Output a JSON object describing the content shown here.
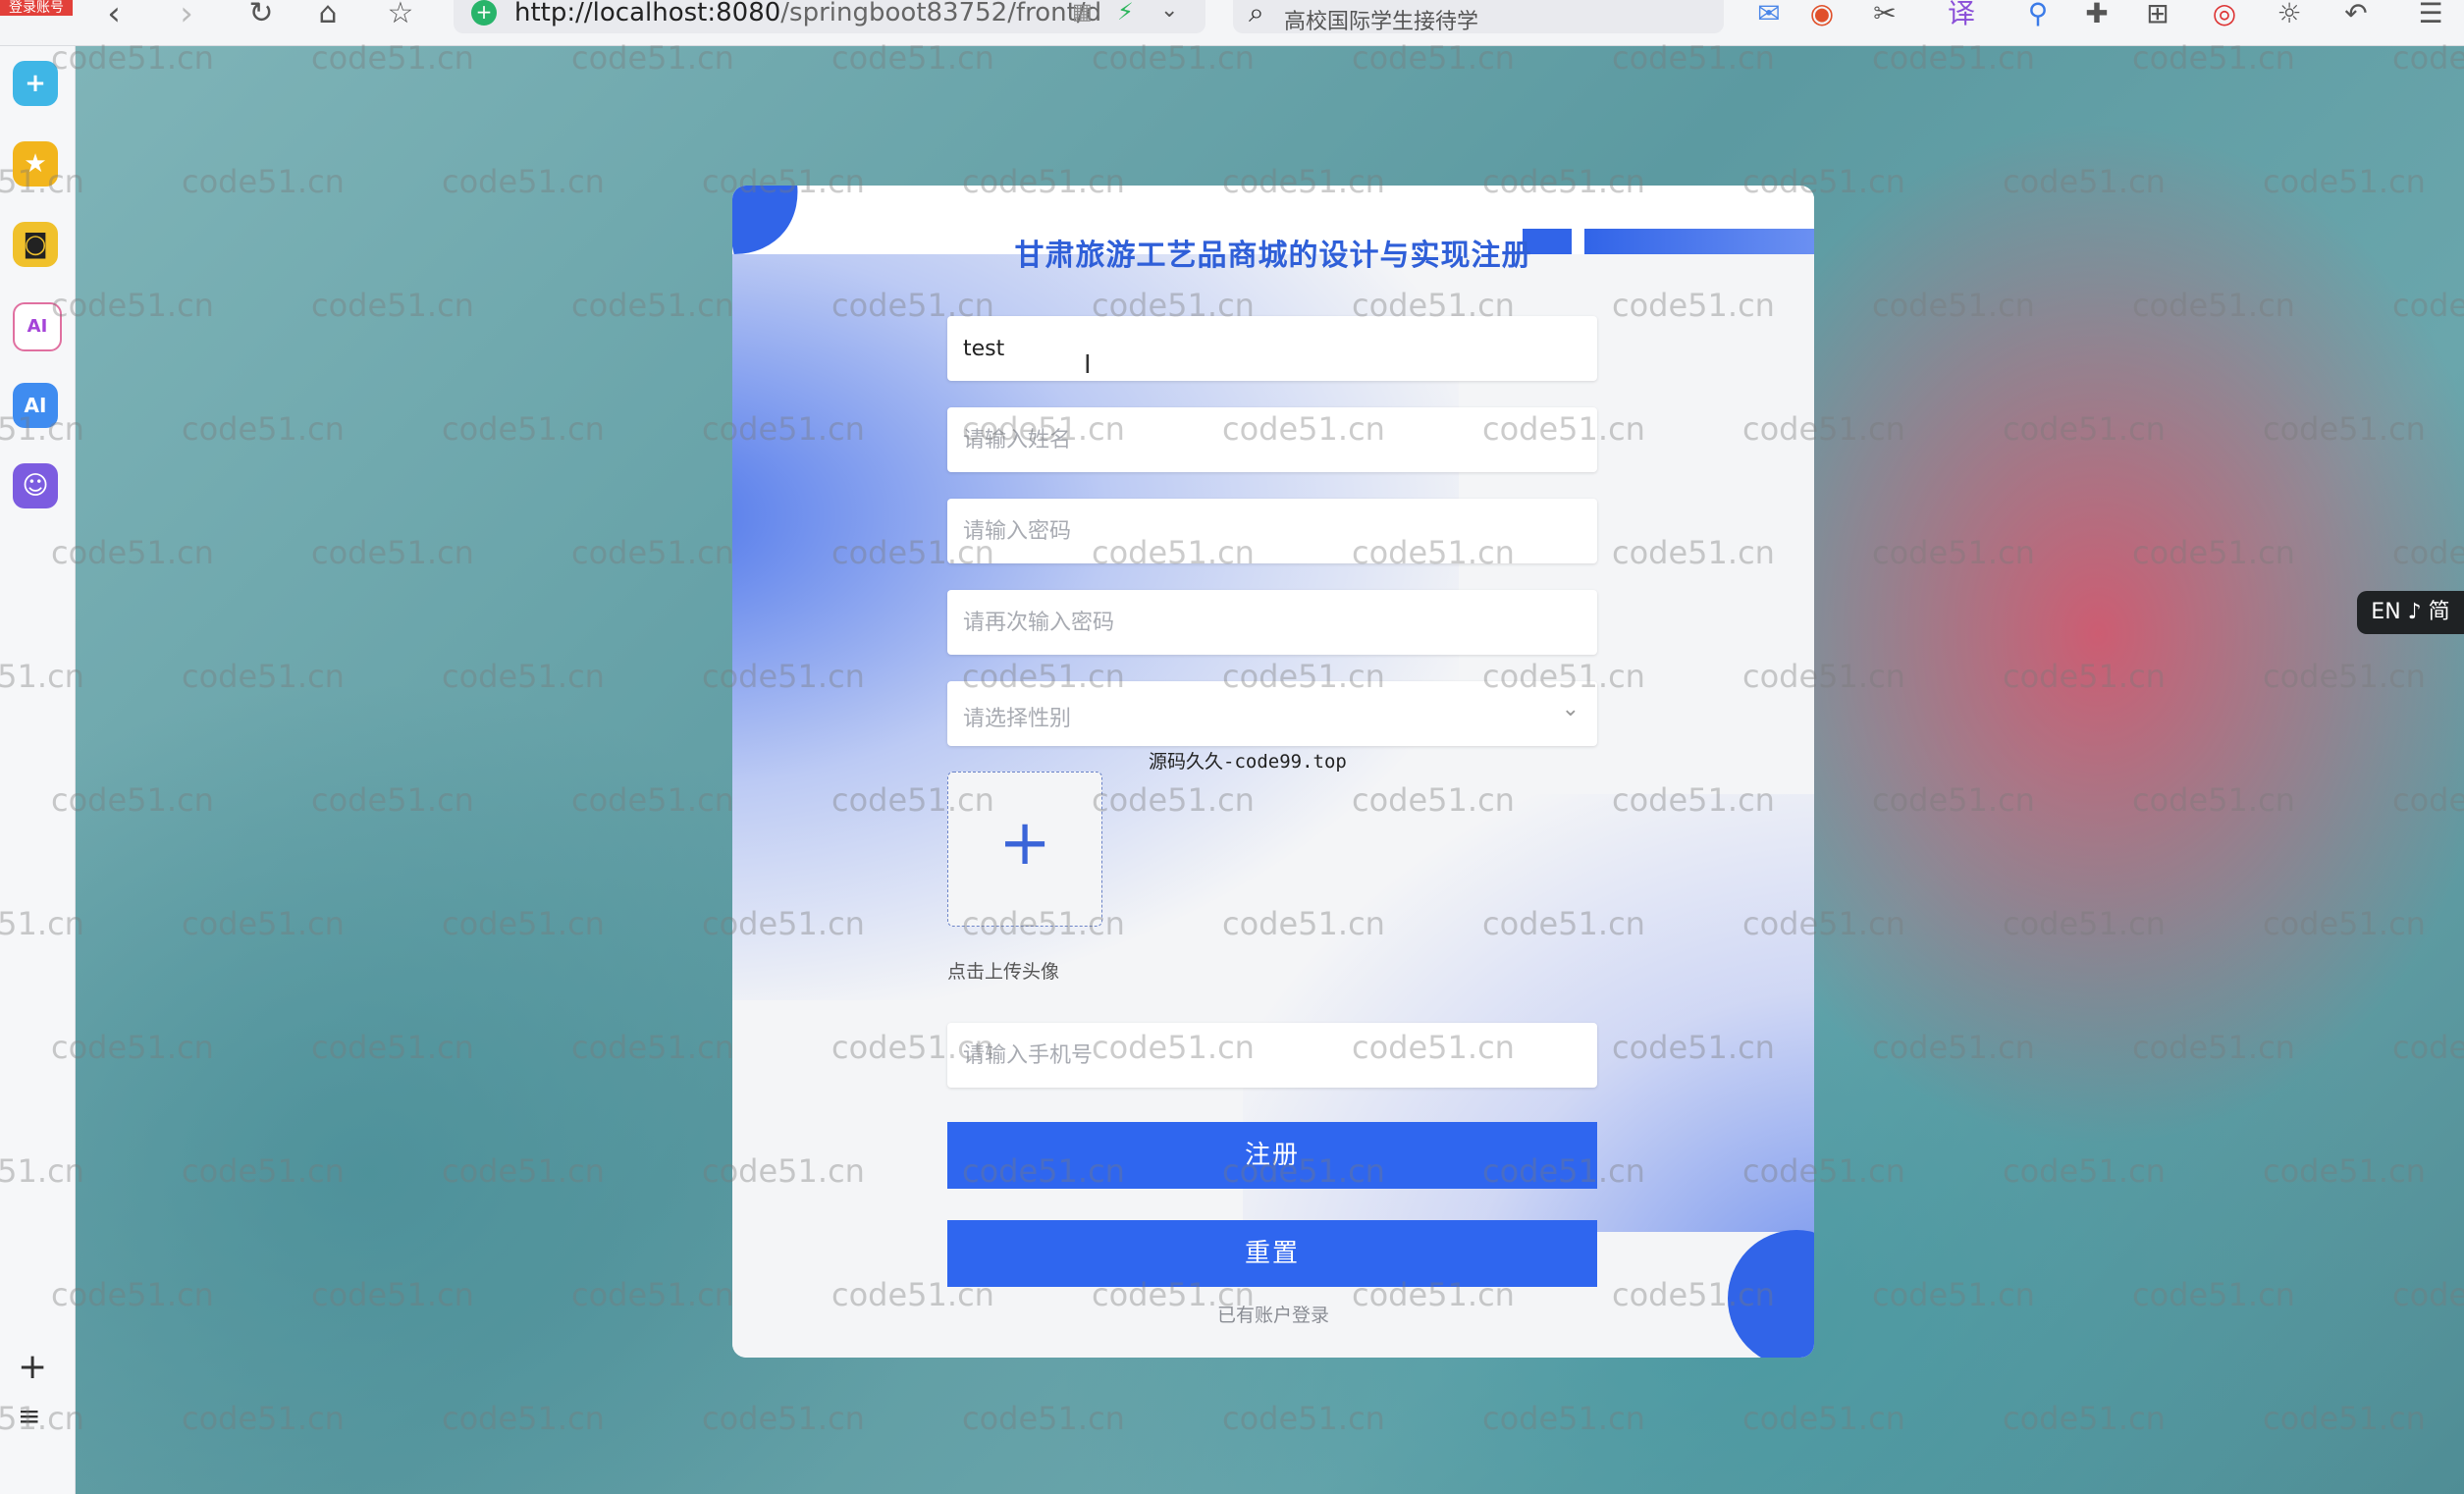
{
  "browser": {
    "corner_badge": "登录账号",
    "url_host": "http://localhost:8080",
    "url_path": "/springboot83752/front/d",
    "search_text": "高校国际学生接待学"
  },
  "sidebar_icons": [
    "add-app-icon",
    "star-app-icon",
    "robot-app-icon",
    "ai-circle-app-icon",
    "ai-square-app-icon",
    "chat-bot-app-icon"
  ],
  "sidebar_bottom": {
    "add": "+",
    "list": "≡"
  },
  "form": {
    "title": "甘肃旅游工艺品商城的设计与实现注册",
    "username_value": "test",
    "name_placeholder": "请输入姓名",
    "password_placeholder": "请输入密码",
    "password_confirm_placeholder": "请再次输入密码",
    "gender_placeholder": "请选择性别",
    "overlay_note": "源码久久-code99.top",
    "upload_tip": "点击上传头像",
    "phone_placeholder": "请输入手机号",
    "register_label": "注册",
    "reset_label": "重置",
    "login_link": "已有账户登录"
  },
  "watermark_text": "code51.cn",
  "ime_badge": "EN ♪ 简",
  "colors": {
    "primary": "#2f66ef",
    "title": "#2f5fd8"
  }
}
